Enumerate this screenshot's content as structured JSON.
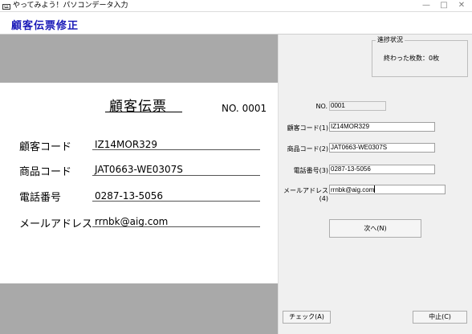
{
  "window": {
    "title": "やってみよう！パソコンデータ入力",
    "icon": "app-keyboard-icon"
  },
  "header": {
    "title": "顧客伝票修正"
  },
  "slip": {
    "title": "顧客伝票",
    "number": "NO. 0001",
    "rows": [
      {
        "label": "顧客コード",
        "value": "IZ14MOR329"
      },
      {
        "label": "商品コード",
        "value": "JAT0663-WE0307S"
      },
      {
        "label": "電話番号",
        "value": "0287-13-5056"
      },
      {
        "label": "メールアドレス",
        "value": "rrnbk@aig.com"
      }
    ]
  },
  "progress": {
    "legend": "進捗状況",
    "text": "終わった枚数：0枚"
  },
  "form": {
    "no_label": "NO.",
    "no_value": "0001",
    "fields": [
      {
        "label": "顧客コード(1)",
        "value": "IZ14MOR329"
      },
      {
        "label": "商品コード(2)",
        "value": "JAT0663-WE0307S"
      },
      {
        "label": "電話番号(3)",
        "value": "0287-13-5056"
      },
      {
        "label": "メールアドレス(4)",
        "value": "rrnbk@aig.com"
      }
    ]
  },
  "buttons": {
    "next": "次へ(N)",
    "check": "チェック(A)",
    "cancel": "中止(C)"
  },
  "colors": {
    "header_title": "#1a1ab8",
    "slip_margin": "#a9a9a9"
  }
}
